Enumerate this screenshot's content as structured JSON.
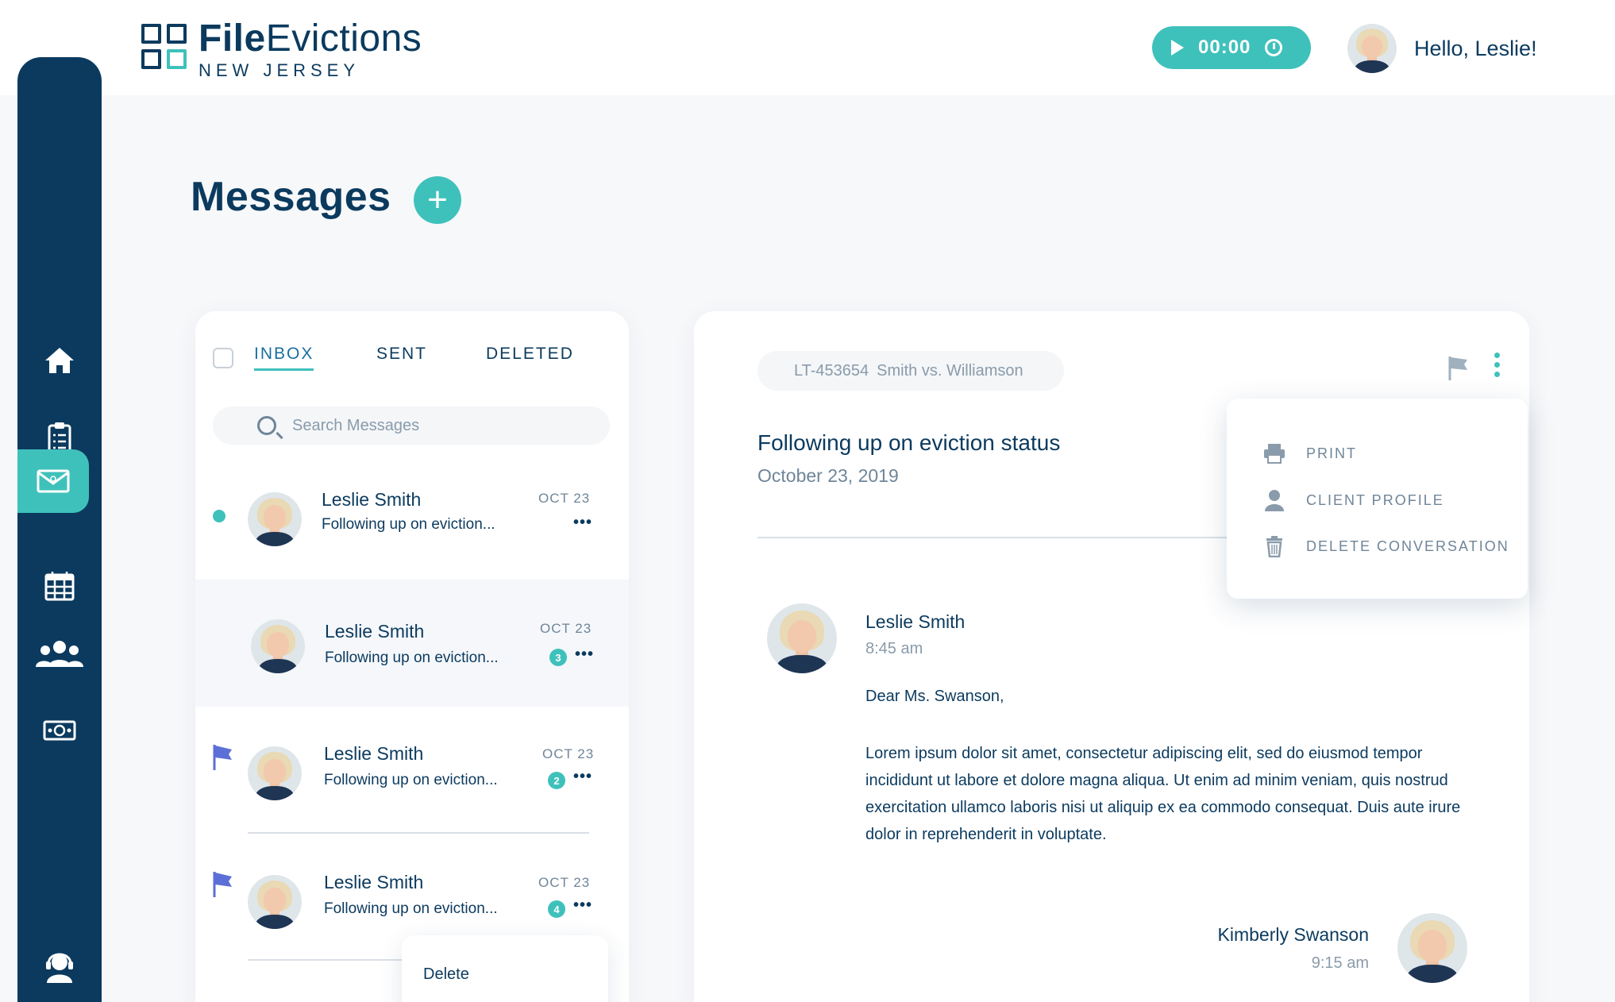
{
  "brand": {
    "name_bold": "File",
    "name_rest": "Evictions",
    "subtitle": "NEW JERSEY"
  },
  "header": {
    "timer": "00:00",
    "greeting": "Hello, Leslie!"
  },
  "sidebar": {
    "items": [
      {
        "icon": "home-icon",
        "active": false
      },
      {
        "icon": "clipboard-icon",
        "active": false
      },
      {
        "icon": "mail-icon",
        "active": true
      },
      {
        "icon": "calendar-icon",
        "active": false
      },
      {
        "icon": "users-icon",
        "active": false
      },
      {
        "icon": "money-icon",
        "active": false
      },
      {
        "icon": "support-icon",
        "active": false
      }
    ]
  },
  "page": {
    "title": "Messages",
    "add_label": "+"
  },
  "list": {
    "tabs": [
      {
        "label": "INBOX",
        "active": true
      },
      {
        "label": "SENT",
        "active": false
      },
      {
        "label": "DELETED",
        "active": false
      }
    ],
    "search_placeholder": "Search Messages",
    "messages": [
      {
        "name": "Leslie Smith",
        "preview": "Following up on eviction...",
        "date": "OCT 23",
        "unread": true,
        "count": "",
        "flagged": false
      },
      {
        "name": "Leslie Smith",
        "preview": "Following up on eviction...",
        "date": "OCT 23",
        "unread": false,
        "count": "3",
        "flagged": false
      },
      {
        "name": "Leslie Smith",
        "preview": "Following up on eviction...",
        "date": "OCT 23",
        "unread": false,
        "count": "2",
        "flagged": true
      },
      {
        "name": "Leslie Smith",
        "preview": "Following up on eviction...",
        "date": "OCT 23",
        "unread": false,
        "count": "4",
        "flagged": true
      }
    ],
    "more_label": "•••",
    "context_menu": {
      "delete_label": "Delete"
    }
  },
  "detail": {
    "case_number": "LT-453654",
    "case_title": "Smith vs. Williamson",
    "subject": "Following up on eviction status",
    "date": "October 23, 2019",
    "sender": {
      "name": "Leslie Smith",
      "time": "8:45 am"
    },
    "greeting": "Dear Ms. Swanson,",
    "body": "Lorem ipsum dolor sit amet, consectetur adipiscing elit, sed do eiusmod tempor incididunt ut labore et dolore magna aliqua. Ut enim ad minim veniam, quis nostrud exercitation ullamco laboris nisi ut aliquip ex ea commodo consequat. Duis aute irure dolor in reprehenderit in voluptate.",
    "reply": {
      "name": "Kimberly Swanson",
      "time": "9:15 am"
    },
    "menu": {
      "print_label": "PRINT",
      "profile_label": "CLIENT PROFILE",
      "delete_label": "DELETE CONVERSATION"
    }
  },
  "colors": {
    "navy": "#0b3a5e",
    "teal": "#3fc1bb",
    "flag": "#5b6fd6"
  }
}
